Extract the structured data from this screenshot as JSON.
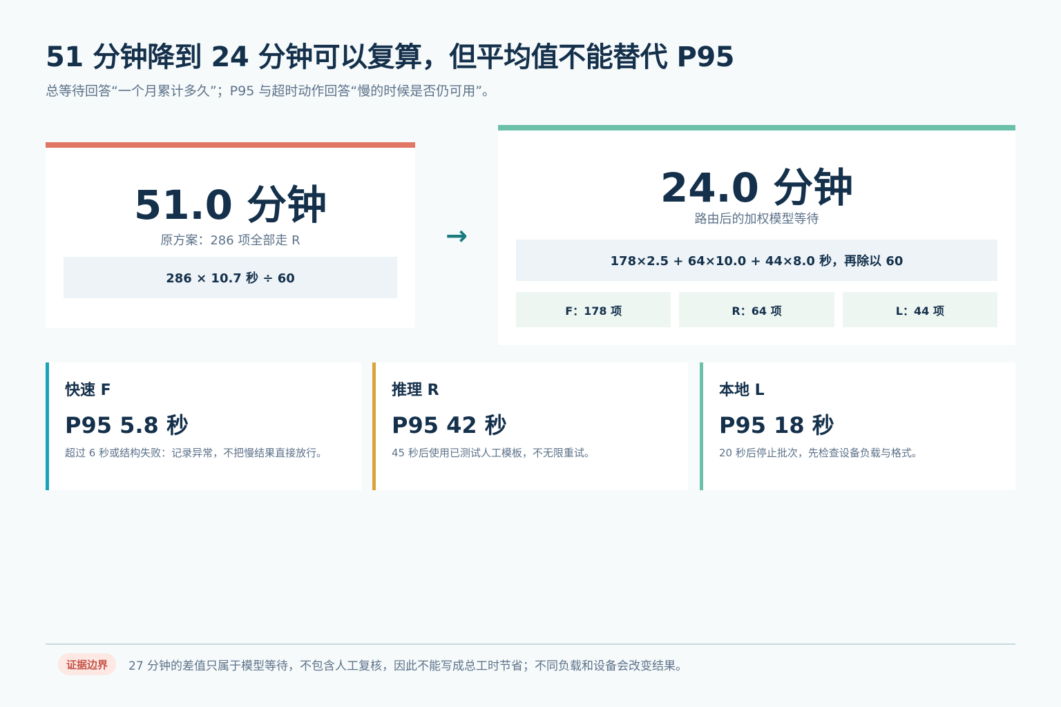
{
  "header": {
    "title": "51 分钟降到 24 分钟可以复算，但平均值不能替代 P95",
    "subtitle": "总等待回答“一个月累计多久”；P95 与超时动作回答“慢的时候是否仍可用”。"
  },
  "before": {
    "value": "51.0 分钟",
    "caption": "原方案：286 项全部走 R",
    "formula": "286 × 10.7 秒 ÷ 60"
  },
  "arrow": "→",
  "after": {
    "value": "24.0 分钟",
    "caption": "路由后的加权模型等待",
    "formula": "178×2.5 + 64×10.0 + 44×8.0 秒，再除以 60",
    "counts": [
      "F：178 项",
      "R：64 项",
      "L：44 项"
    ]
  },
  "tiers": [
    {
      "name": "快速 F",
      "p95": "P95 5.8 秒",
      "desc": "超过 6 秒或结构失败：记录异常，不把慢结果直接放行。"
    },
    {
      "name": "推理 R",
      "p95": "P95 42 秒",
      "desc": "45 秒后使用已测试人工模板，不无限重试。"
    },
    {
      "name": "本地 L",
      "p95": "P95 18 秒",
      "desc": "20 秒后停止批次，先检查设备负载与格式。"
    }
  ],
  "footer": {
    "badge": "证据边界",
    "note": "27 分钟的差值只属于模型等待，不包含人工复核，因此不能写成总工时节省；不同负载和设备会改变结果。"
  },
  "colors": {
    "before_accent": "#e07663",
    "after_accent": "#6cbfa9",
    "tier_f": "#1aa3b8",
    "tier_r": "#dba33c",
    "tier_l": "#6cbfa9",
    "arrow": "#1b7b7f"
  }
}
